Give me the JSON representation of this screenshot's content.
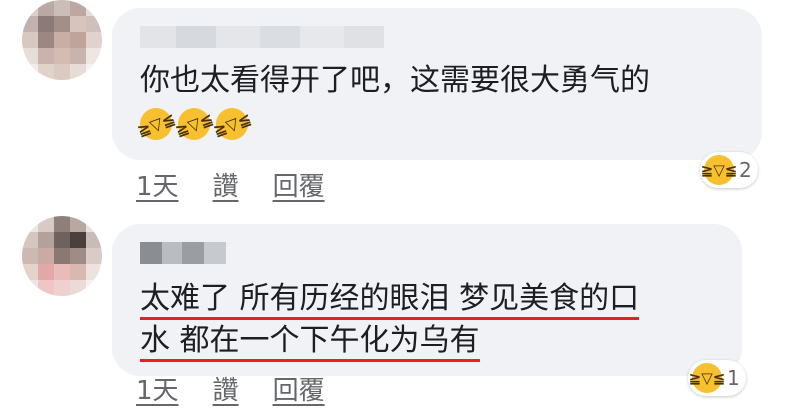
{
  "comments": [
    {
      "text_lines": [
        "你也太看得开了吧，这需要很大勇气的"
      ],
      "emoji_count": 3,
      "emoji_icon": "rolling-on-floor-laughing",
      "reaction_icon": "laughing-face",
      "reaction_count": "2",
      "time": "1天",
      "like": "讚",
      "reply": "回覆"
    },
    {
      "text_lines": [
        "太难了 所有历经的眼泪 梦见美食的口",
        "水 都在一个下午化为乌有"
      ],
      "underline_color": "#e0242b",
      "reaction_icon": "laughing-face",
      "reaction_count": "1",
      "time": "1天",
      "like": "讚",
      "reply": "回覆"
    }
  ],
  "colors": {
    "bubble_bg": "#f0f2f5",
    "text": "#1c1e21",
    "meta": "#65676b",
    "emoji": "#f7c02e"
  }
}
